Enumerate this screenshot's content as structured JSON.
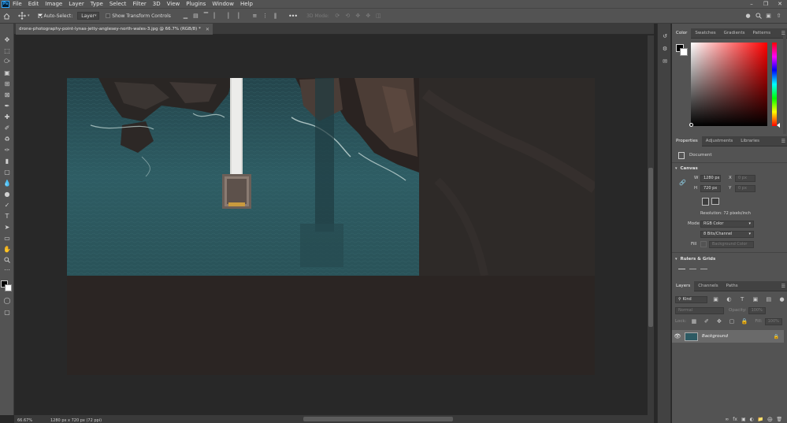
{
  "menubar": {
    "logo": "Ps",
    "items": [
      "File",
      "Edit",
      "Image",
      "Layer",
      "Type",
      "Select",
      "Filter",
      "3D",
      "View",
      "Plugins",
      "Window",
      "Help"
    ]
  },
  "options": {
    "auto_select_label": "Auto-Select:",
    "auto_select_value": "Layer",
    "show_transform_label": "Show Transform Controls",
    "mode_3d_label": "3D Mode:"
  },
  "document": {
    "tab_title": "drone-photography-point-lynas-jetty-anglesey-north-wales-3.jpg @ 66.7% (RGB/8) *"
  },
  "status": {
    "zoom": "66.67%",
    "doc_size": "1280 px x 720 px (72 ppi)"
  },
  "color_panel": {
    "tabs": [
      "Color",
      "Swatches",
      "Gradients",
      "Patterns"
    ],
    "active_tab": "Color",
    "foreground": "#000000",
    "background": "#ffffff"
  },
  "properties_panel": {
    "tabs": [
      "Properties",
      "Adjustments",
      "Libraries"
    ],
    "active_tab": "Properties",
    "kind": "Document",
    "canvas_section": "Canvas",
    "w_label": "W",
    "w_value": "1280 px",
    "h_label": "H",
    "h_value": "720 px",
    "x_label": "X",
    "x_value": "0 px",
    "y_label": "Y",
    "y_value": "0 px",
    "resolution": "Resolution: 72 pixels/inch",
    "mode_label": "Mode",
    "mode_value": "RGB Color",
    "depth_value": "8 Bits/Channel",
    "fill_label": "Fill",
    "fill_value": "Background Color",
    "rulers_section": "Rulers & Grids"
  },
  "layers_panel": {
    "tabs": [
      "Layers",
      "Channels",
      "Paths"
    ],
    "active_tab": "Layers",
    "filter_placeholder": "Kind",
    "blend_mode": "Normal",
    "opacity_label": "Opacity:",
    "opacity_value": "100%",
    "lock_label": "Lock:",
    "fill_label": "Fill:",
    "fill_value": "100%",
    "layers": [
      {
        "name": "Background",
        "visible": true,
        "locked": true
      }
    ]
  }
}
